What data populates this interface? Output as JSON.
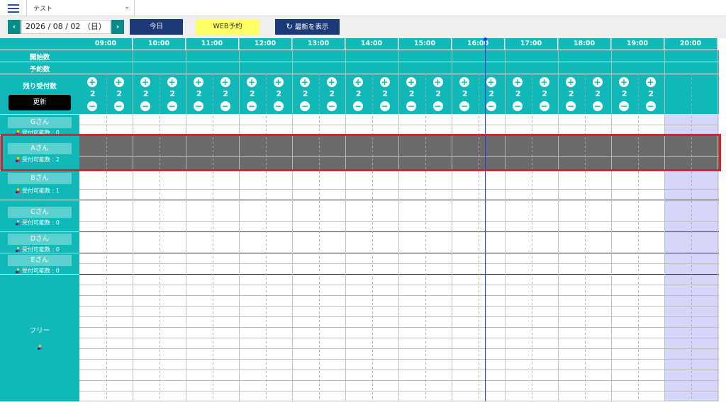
{
  "topbar": {
    "store_name": "テスト"
  },
  "toolbar": {
    "prev_label": "‹",
    "next_label": "›",
    "date": "2026 / 08 / 02 （日）",
    "today_label": "今日",
    "web_label": "WEB予約",
    "refresh_label": "最新を表示"
  },
  "header": {
    "start_count_label": "開始数",
    "reservation_count_label": "予約数",
    "remaining_label": "残り受付数",
    "update_label": "更新",
    "hours": [
      "09:00",
      "10:00",
      "11:00",
      "12:00",
      "13:00",
      "14:00",
      "15:00",
      "16:00",
      "17:00",
      "18:00",
      "19:00",
      "20:00"
    ],
    "remaining_values": [
      "2",
      "2",
      "2",
      "2",
      "2",
      "2",
      "2",
      "2",
      "2",
      "2",
      "2",
      "2",
      "2",
      "2",
      "2",
      "2",
      "2",
      "2",
      "2",
      "2",
      "2",
      "2"
    ],
    "plus_symbol": "+",
    "minus_symbol": "−"
  },
  "staff": [
    {
      "name": "Gさん",
      "capacity": "受付可能数 : 0"
    },
    {
      "name": "Aさん",
      "capacity": "受付可能数 : 2"
    },
    {
      "name": "Bさん",
      "capacity": "受付可能数 : 1"
    },
    {
      "name": "Cさん",
      "capacity": "受付可能数 : 0"
    },
    {
      "name": "Dさん",
      "capacity": "受付可能数 : 0"
    },
    {
      "name": "Eさん",
      "capacity": "受付可能数 : 0"
    }
  ],
  "free_label": "フリー",
  "colors": {
    "teal": "#10b8b8",
    "navy": "#1c3a78",
    "yellow": "#ffff66",
    "blocked": "#6b6b6b",
    "closed": "#d6d6fb",
    "now_line": "#2233ee",
    "highlight": "#e31d2b"
  },
  "icons": {
    "menu": "hamburger-icon",
    "dropdown": "chevron-down-icon",
    "refresh": "refresh-icon",
    "person": "person-icon"
  }
}
